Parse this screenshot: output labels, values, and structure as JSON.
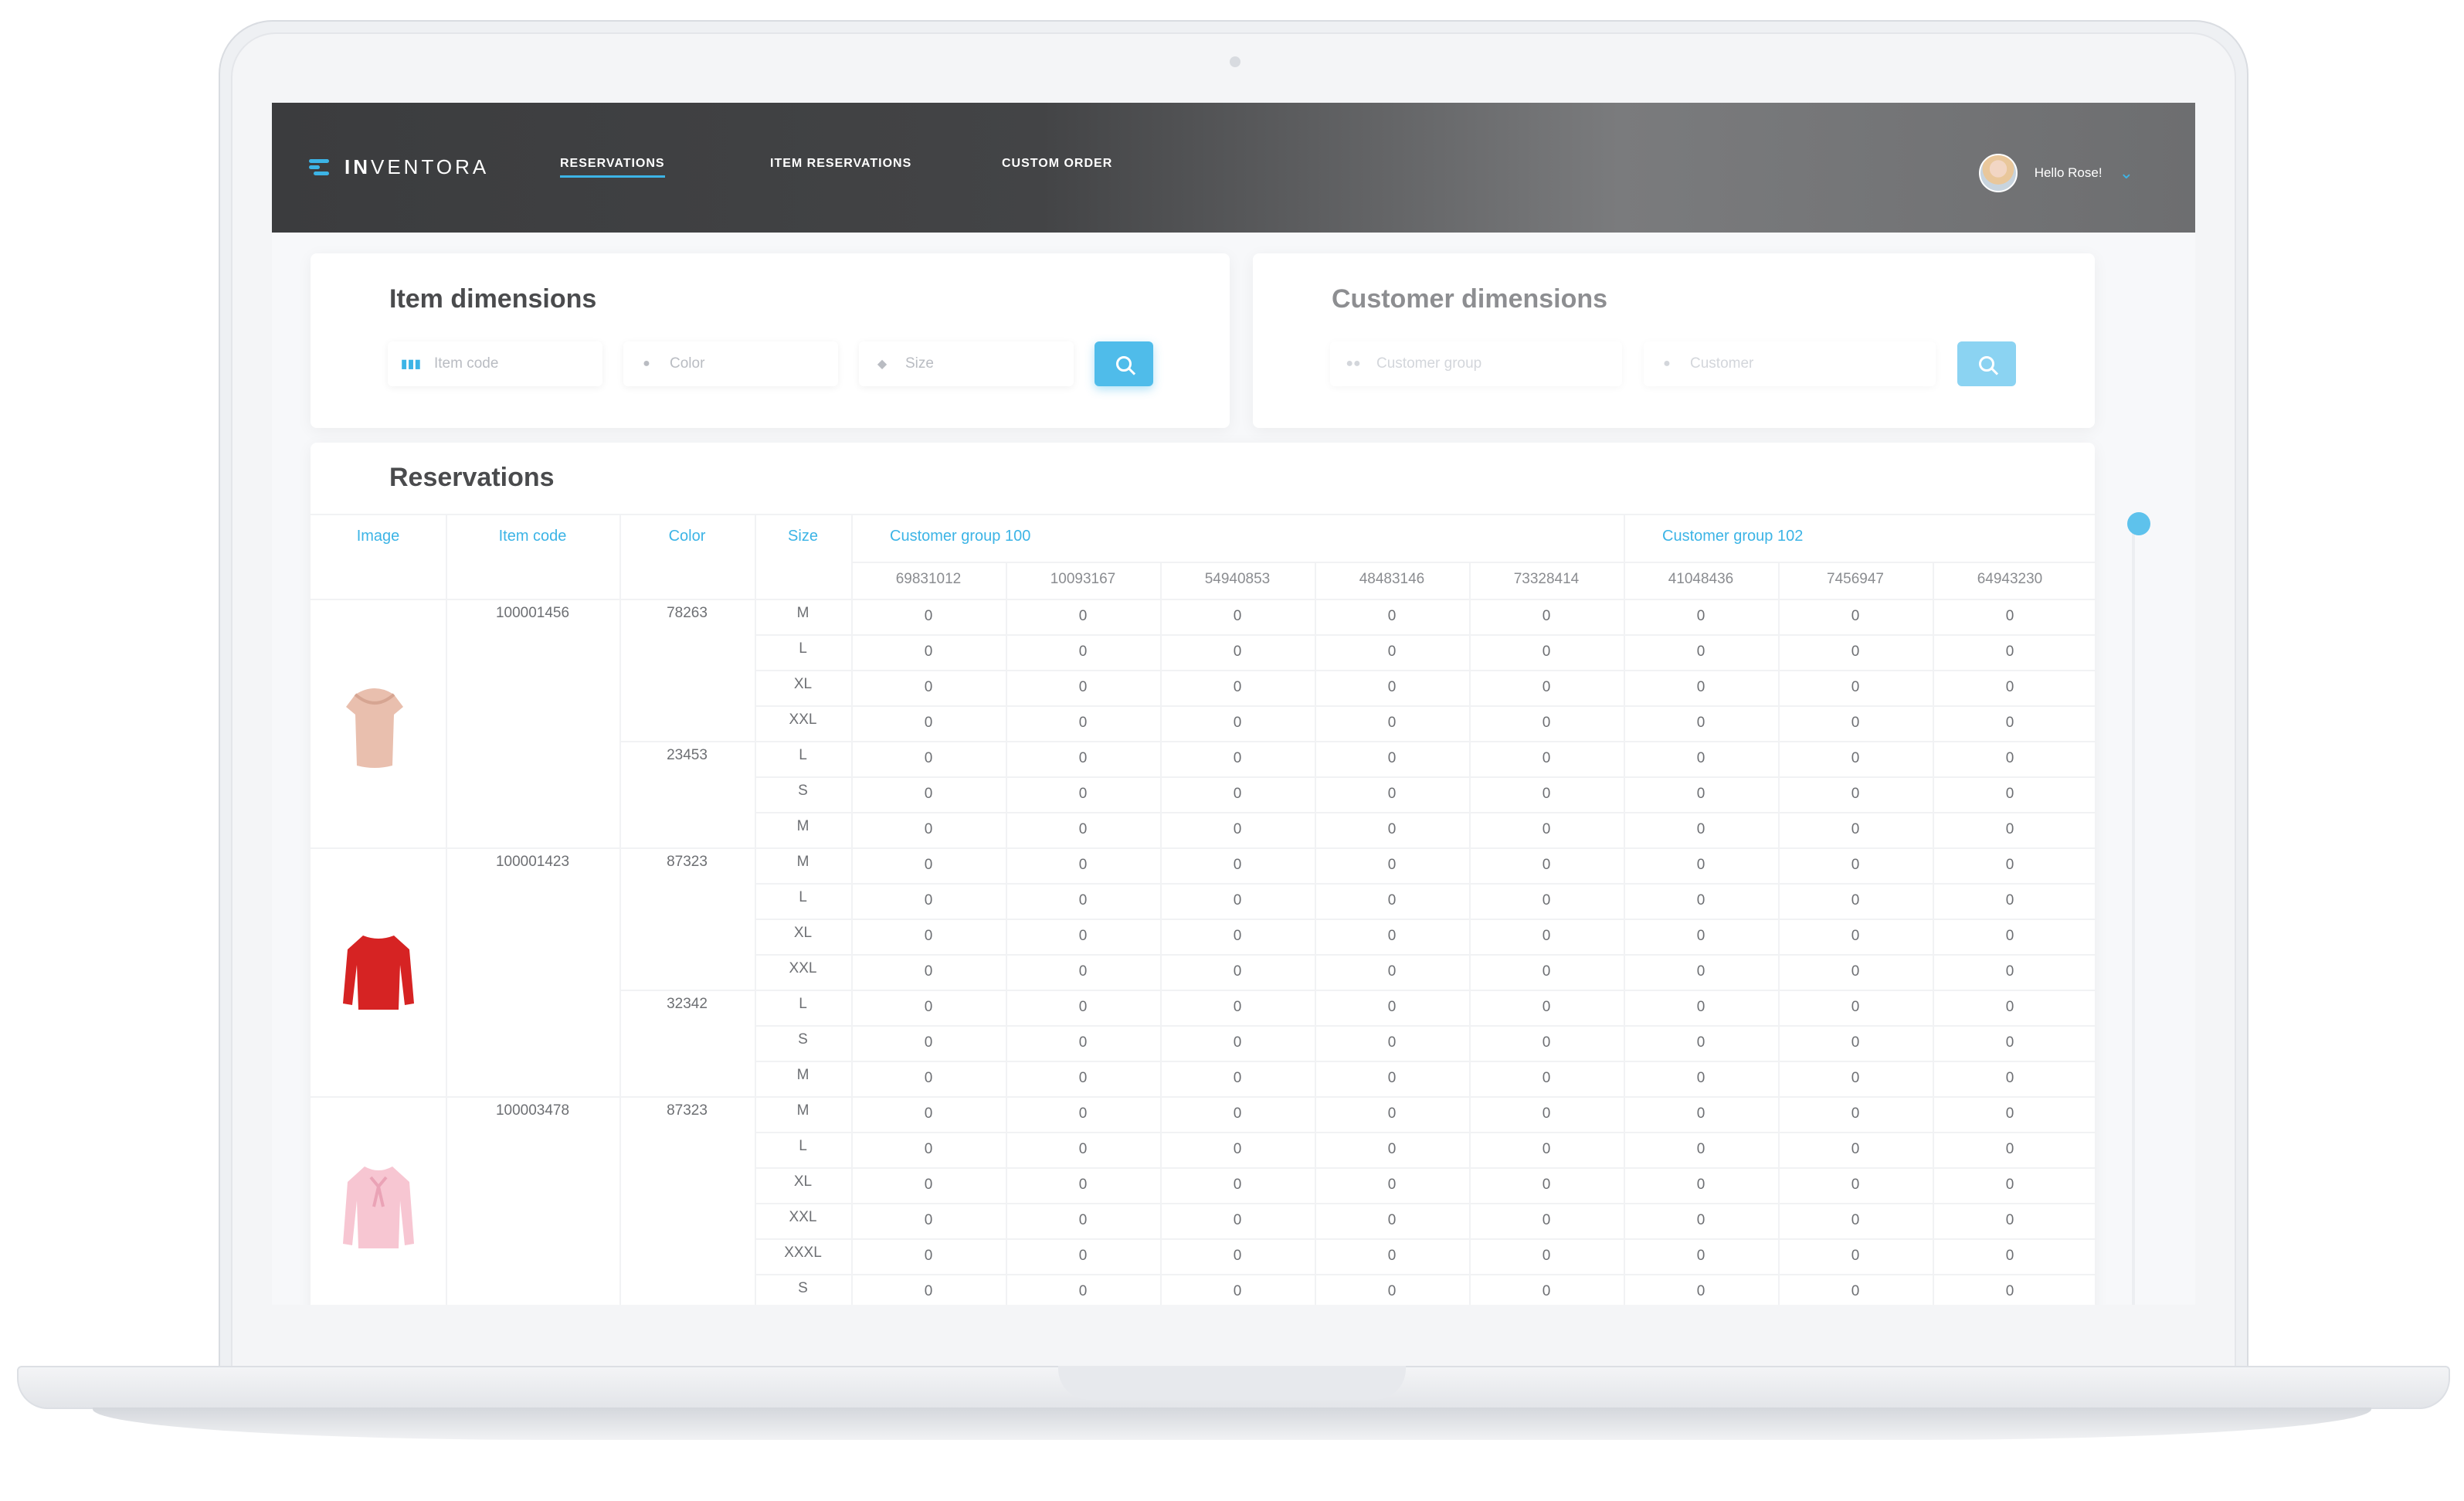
{
  "app": {
    "logo_bold": "IN",
    "logo_rest": "VENTORA",
    "nav": [
      {
        "label": "RESERVATIONS",
        "active": true
      },
      {
        "label": "ITEM RESERVATIONS",
        "active": false
      },
      {
        "label": "CUSTOM ORDER",
        "active": false
      }
    ],
    "greeting": "Hello Rose!"
  },
  "item_dimensions": {
    "title": "Item dimensions",
    "fields": [
      {
        "placeholder": "Item code",
        "icon": "barcode-icon"
      },
      {
        "placeholder": "Color",
        "icon": "palette-icon"
      },
      {
        "placeholder": "Size",
        "icon": "tag-icon"
      }
    ]
  },
  "customer_dimensions": {
    "title": "Customer dimensions",
    "fields": [
      {
        "placeholder": "Customer group",
        "icon": "group-icon"
      },
      {
        "placeholder": "Customer",
        "icon": "person-icon"
      }
    ]
  },
  "reservations": {
    "title": "Reservations",
    "columns": [
      "Image",
      "Item code",
      "Color",
      "Size"
    ],
    "customer_groups": [
      {
        "name": "Customer group 100",
        "customers": [
          "69831012",
          "10093167",
          "54940853",
          "48483146",
          "73328414"
        ]
      },
      {
        "name": "Customer group 102",
        "customers": [
          "41048436",
          "7456947",
          "64943230"
        ]
      }
    ],
    "items": [
      {
        "code": "100001456",
        "image": "beige-ruffle-top",
        "colors": [
          {
            "color": "78263",
            "sizes": [
              "M",
              "L",
              "XL",
              "XXL"
            ]
          },
          {
            "color": "23453",
            "sizes": [
              "L",
              "S",
              "M"
            ]
          }
        ]
      },
      {
        "code": "100001423",
        "image": "red-blouse",
        "colors": [
          {
            "color": "87323",
            "sizes": [
              "M",
              "L",
              "XL",
              "XXL"
            ]
          },
          {
            "color": "32342",
            "sizes": [
              "L",
              "S",
              "M"
            ]
          }
        ]
      },
      {
        "code": "100003478",
        "image": "pink-bow-blouse",
        "colors": [
          {
            "color": "87323",
            "sizes": [
              "M",
              "L",
              "XL",
              "XXL",
              "XXXL",
              "S"
            ]
          }
        ]
      }
    ],
    "cell_value": "0"
  },
  "colors": {
    "accent": "#3cb4e6",
    "button": "#4fbcea"
  }
}
